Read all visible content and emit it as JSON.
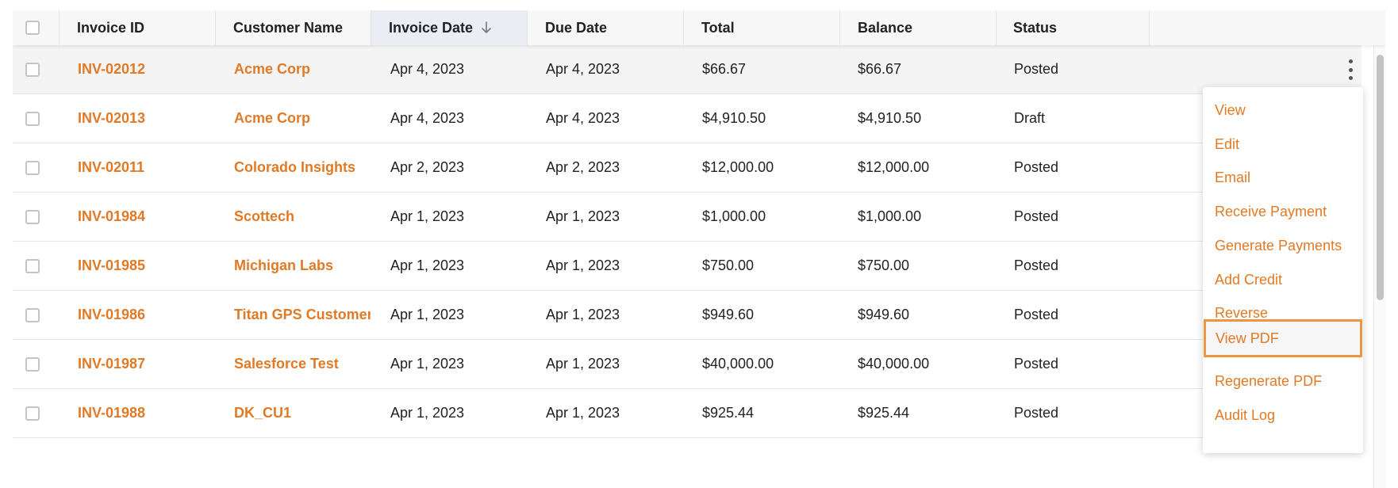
{
  "colors": {
    "accent": "#e07a26",
    "focus_border": "#f0953f",
    "header_bg": "#f7f7f8",
    "sorted_header_bg": "#ebedf5"
  },
  "table": {
    "columns": [
      "Invoice ID",
      "Customer Name",
      "Invoice Date",
      "Due Date",
      "Total",
      "Balance",
      "Status"
    ],
    "sorted_column": "Invoice Date",
    "sort_direction": "descending",
    "sort_icon": "arrow-down-icon",
    "rows": [
      {
        "invoice_id": "INV-02012",
        "customer": "Acme Corp",
        "invoice_date": "Apr 4, 2023",
        "due_date": "Apr 4, 2023",
        "total": "$66.67",
        "balance": "$66.67",
        "status": "Posted"
      },
      {
        "invoice_id": "INV-02013",
        "customer": "Acme Corp",
        "invoice_date": "Apr 4, 2023",
        "due_date": "Apr 4, 2023",
        "total": "$4,910.50",
        "balance": "$4,910.50",
        "status": "Draft"
      },
      {
        "invoice_id": "INV-02011",
        "customer": "Colorado Insights",
        "invoice_date": "Apr 2, 2023",
        "due_date": "Apr 2, 2023",
        "total": "$12,000.00",
        "balance": "$12,000.00",
        "status": "Posted"
      },
      {
        "invoice_id": "INV-01984",
        "customer": "Scottech",
        "invoice_date": "Apr 1, 2023",
        "due_date": "Apr 1, 2023",
        "total": "$1,000.00",
        "balance": "$1,000.00",
        "status": "Posted"
      },
      {
        "invoice_id": "INV-01985",
        "customer": "Michigan Labs",
        "invoice_date": "Apr 1, 2023",
        "due_date": "Apr 1, 2023",
        "total": "$750.00",
        "balance": "$750.00",
        "status": "Posted"
      },
      {
        "invoice_id": "INV-01986",
        "customer": "Titan GPS Customer X",
        "invoice_date": "Apr 1, 2023",
        "due_date": "Apr 1, 2023",
        "total": "$949.60",
        "balance": "$949.60",
        "status": "Posted"
      },
      {
        "invoice_id": "INV-01987",
        "customer": "Salesforce Test",
        "invoice_date": "Apr 1, 2023",
        "due_date": "Apr 1, 2023",
        "total": "$40,000.00",
        "balance": "$40,000.00",
        "status": "Posted"
      },
      {
        "invoice_id": "INV-01988",
        "customer": "DK_CU1",
        "invoice_date": "Apr 1, 2023",
        "due_date": "Apr 1, 2023",
        "total": "$925.44",
        "balance": "$925.44",
        "status": "Posted"
      }
    ]
  },
  "row_menu": {
    "trigger_icon": "more-vertical-icon",
    "items": [
      "View",
      "Edit",
      "Email",
      "Receive Payment",
      "Generate Payments",
      "Add Credit",
      "Reverse",
      "View PDF",
      "Regenerate PDF",
      "Audit Log"
    ],
    "focused_item": "View PDF"
  }
}
